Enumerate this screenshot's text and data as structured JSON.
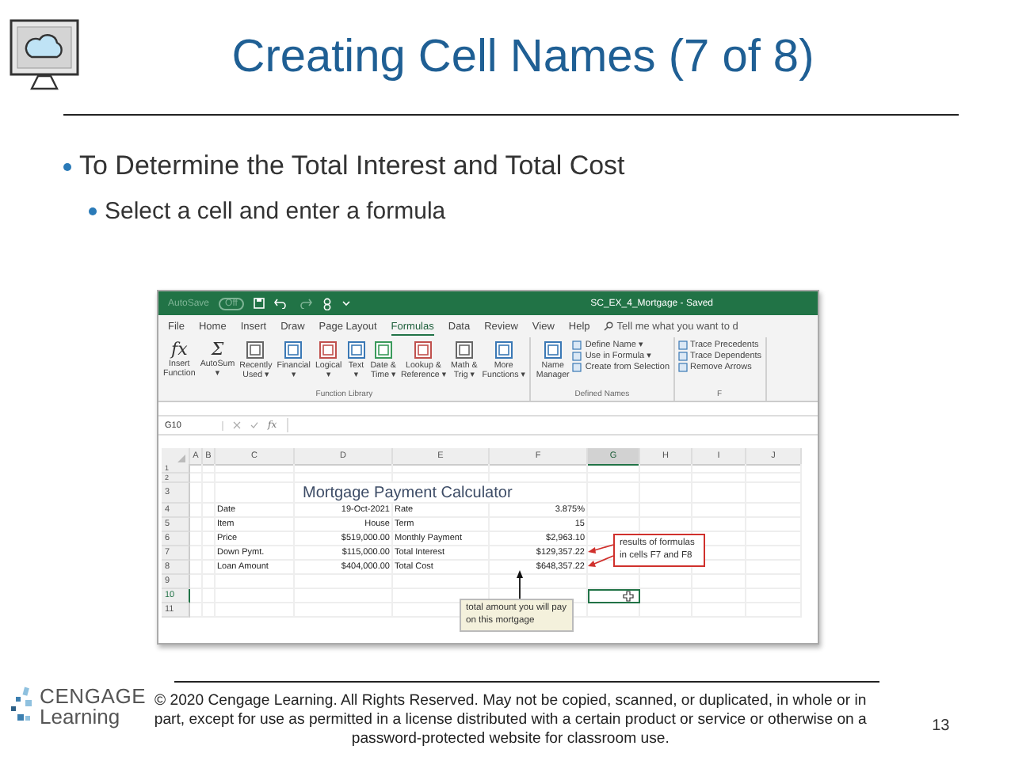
{
  "slide": {
    "title": "Creating Cell Names (7 of 8)",
    "bullets": [
      {
        "text": "To Determine the Total Interest and Total Cost",
        "children": [
          {
            "text": "Select a cell and enter a formula"
          }
        ]
      }
    ]
  },
  "excel": {
    "title_bar": {
      "autosave": "AutoSave",
      "autosave_state": "Off",
      "document": "SC_EX_4_Mortgage  -  Saved"
    },
    "tabs": [
      {
        "label": "File",
        "selected": false
      },
      {
        "label": "Home",
        "selected": false
      },
      {
        "label": "Insert",
        "selected": false
      },
      {
        "label": "Draw",
        "selected": false
      },
      {
        "label": "Page Layout",
        "selected": false
      },
      {
        "label": "Formulas",
        "selected": true
      },
      {
        "label": "Data",
        "selected": false
      },
      {
        "label": "Review",
        "selected": false
      },
      {
        "label": "View",
        "selected": false
      },
      {
        "label": "Help",
        "selected": false
      }
    ],
    "tell_me": "Tell me what you want to d",
    "ribbon_groups": [
      {
        "label": "Function Library",
        "buttons": [
          {
            "label": "Insert\nFunction",
            "glyph": "fx"
          },
          {
            "label": "AutoSum\n▾",
            "glyph": "Σ"
          },
          {
            "label": "Recently\nUsed ▾"
          },
          {
            "label": "Financial\n▾"
          },
          {
            "label": "Logical\n▾"
          },
          {
            "label": "Text\n▾"
          },
          {
            "label": "Date &\nTime ▾"
          },
          {
            "label": "Lookup &\nReference ▾"
          },
          {
            "label": "Math &\nTrig ▾"
          },
          {
            "label": "More\nFunctions ▾"
          }
        ]
      },
      {
        "label": "Defined Names",
        "buttons": [
          {
            "label": "Name\nManager"
          }
        ],
        "small_buttons": [
          "Define Name ▾",
          "Use in Formula ▾",
          "Create from Selection"
        ]
      },
      {
        "label": "F",
        "small_buttons": [
          "Trace Precedents",
          "Trace Dependents",
          "Remove Arrows"
        ]
      }
    ],
    "name_box": "G10",
    "function_label": "fx",
    "columns": [
      {
        "label": "A",
        "selected": false
      },
      {
        "label": "B",
        "selected": false
      },
      {
        "label": "C",
        "selected": false
      },
      {
        "label": "D",
        "selected": false
      },
      {
        "label": "E",
        "selected": false
      },
      {
        "label": "F",
        "selected": false
      },
      {
        "label": "G",
        "selected": true
      },
      {
        "label": "H",
        "selected": false
      },
      {
        "label": "I",
        "selected": false
      },
      {
        "label": "J",
        "selected": false
      }
    ],
    "rows": [
      {
        "number": "1",
        "selected": false
      },
      {
        "number": "2",
        "selected": false
      },
      {
        "number": "3",
        "selected": false,
        "title": "Mortgage Payment Calculator"
      },
      {
        "number": "4",
        "selected": false,
        "cells": [
          "Date",
          "19-Oct-2021",
          "Rate",
          "3.875%"
        ]
      },
      {
        "number": "5",
        "selected": false,
        "cells": [
          "Item",
          "House",
          "Term",
          "15"
        ]
      },
      {
        "number": "6",
        "selected": false,
        "cells": [
          "Price",
          "$519,000.00",
          "Monthly Payment",
          "$2,963.10"
        ]
      },
      {
        "number": "7",
        "selected": false,
        "cells": [
          "Down Pymt.",
          "$115,000.00",
          "Total Interest",
          "$129,357.22"
        ]
      },
      {
        "number": "8",
        "selected": false,
        "cells": [
          "Loan Amount",
          "$404,000.00",
          "Total Cost",
          "$648,357.22"
        ]
      },
      {
        "number": "9",
        "selected": false
      },
      {
        "number": "10",
        "selected": true
      },
      {
        "number": "11",
        "selected": false
      }
    ],
    "callouts": [
      {
        "kind": "red",
        "text": "results of formulas in cells F7 and F8"
      },
      {
        "kind": "note",
        "text": "total amount you will pay on this mortgage"
      }
    ]
  },
  "footer": {
    "logo_top": "CENGAGE",
    "logo_bottom": "Learning",
    "copyright": "© 2020 Cengage Learning. All Rights Reserved. May not be copied, scanned, or duplicated, in whole or in part, except for use as permitted in a license distributed with a certain product or service or otherwise on a password-protected website for classroom use.",
    "page": "13"
  }
}
